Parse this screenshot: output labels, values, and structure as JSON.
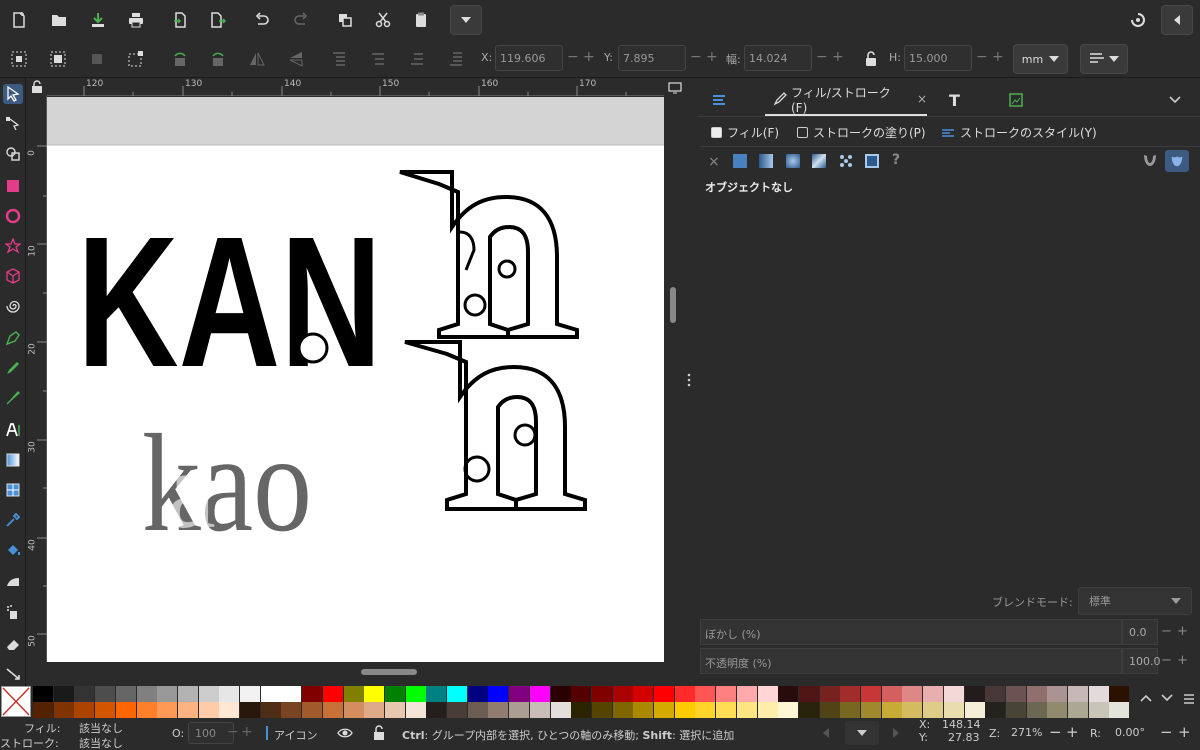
{
  "toolbar": {
    "x_label": "X:",
    "x_value": "119.606",
    "y_label": "Y:",
    "y_value": "7.895",
    "w_label": "幅:",
    "w_value": "14.024",
    "h_label": "H:",
    "h_value": "15.000",
    "unit": "mm"
  },
  "ruler": {
    "h_ticks": [
      "120",
      "130",
      "140",
      "150",
      "160",
      "170"
    ],
    "v_ticks": [
      "0",
      "10",
      "20",
      "30",
      "40",
      "50"
    ]
  },
  "canvas_art": {
    "logo_text": "KAN",
    "small_logo_text": "kao"
  },
  "panel": {
    "tab_label": "フィル/ストローク(F)",
    "subtabs": [
      "フィル(F)",
      "ストロークの塗り(P)",
      "ストロークのスタイル(Y)"
    ],
    "no_object": "オブジェクトなし",
    "blend_label": "ブレンドモード:",
    "blend_value": "標準",
    "blur_label": "ぼかし (%)",
    "blur_value": "0.0",
    "opacity_label": "不透明度 (%)",
    "opacity_value": "100.0"
  },
  "palette": {
    "row1": [
      "#000000",
      "#1a1a1a",
      "#333333",
      "#4d4d4d",
      "#666666",
      "#808080",
      "#999999",
      "#b3b3b3",
      "#cccccc",
      "#e6e6e6",
      "#f2f2f2",
      "#ffffff",
      "#ffffff",
      "#800000",
      "#ff0000",
      "#808000",
      "#ffff00",
      "#008000",
      "#00ff00",
      "#008080",
      "#00ffff",
      "#000080",
      "#0000ff",
      "#800080",
      "#ff00ff",
      "#2b0000",
      "#550000",
      "#800000",
      "#aa0000",
      "#d40000",
      "#ff0000",
      "#ff2a2a",
      "#ff5555",
      "#ff8080",
      "#ffaaaa",
      "#ffd5d5",
      "#280b0b",
      "#501616",
      "#782121",
      "#a02c2c",
      "#c83737",
      "#d35f5f",
      "#de8787",
      "#e9afaf",
      "#f4d7d7",
      "#241c1c",
      "#483737",
      "#6c5353",
      "#916f6f",
      "#ac9393",
      "#c8b7b7",
      "#e3dbdb",
      "#2b1100"
    ],
    "row2": [
      "#552200",
      "#803300",
      "#aa4400",
      "#d45500",
      "#ff6600",
      "#ff7f2a",
      "#ff9955",
      "#ffb380",
      "#ffccaa",
      "#ffe6d5",
      "#28170b",
      "#502d16",
      "#784421",
      "#a05a2c",
      "#c87137",
      "#d38d5f",
      "#deaa87",
      "#e9c6af",
      "#f4e3d7",
      "#241f1c",
      "#483e37",
      "#6c5d53",
      "#917c6f",
      "#ac9d93",
      "#c8beb7",
      "#e3dedb",
      "#2b2200",
      "#554400",
      "#806600",
      "#aa8800",
      "#d4aa00",
      "#ffcc00",
      "#ffd42a",
      "#ffdd55",
      "#ffe680",
      "#ffeeaa",
      "#fff6d5",
      "#28220b",
      "#504416",
      "#786721",
      "#a0892c",
      "#c8ab37",
      "#d4bb5f",
      "#dfcc87",
      "#e9ddaf",
      "#f4eed7",
      "#24221c",
      "#484537",
      "#6c6753",
      "#918a6f",
      "#aca793",
      "#c8c4b7",
      "#e3e2db"
    ]
  },
  "status": {
    "fill_label": "フィル:",
    "fill_value": "該当なし",
    "stroke_label": "ストローク:",
    "stroke_value": "該当なし",
    "opacity_label": "O:",
    "opacity_value": "100",
    "layer_name": "アイコン",
    "hint_ctrl": "Ctrl",
    "hint_mid": ": グループ内部を選択, ひとつの軸のみ移動; ",
    "hint_shift": "Shift",
    "hint_end": ": 選択に追加",
    "cursor_x_label": "X:",
    "cursor_x": "148.14",
    "cursor_y_label": "Y:",
    "cursor_y": "27.83",
    "zoom_label": "Z:",
    "zoom_value": "271%",
    "rotate_label": "R:",
    "rotate_value": "0.00°"
  }
}
